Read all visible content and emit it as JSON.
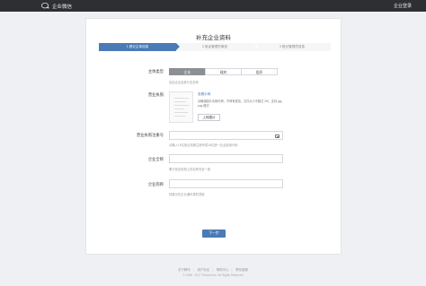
{
  "header": {
    "brand": "企业微信",
    "login_label": "企业登录"
  },
  "card": {
    "title": "补充企业资料",
    "steps": [
      {
        "label": "1.登记主体信息",
        "active": true
      },
      {
        "label": "2.验证管理员微信",
        "active": false
      },
      {
        "label": "3.登记管理员信息",
        "active": false
      }
    ]
  },
  "form": {
    "entity_type": {
      "label": "主体类型",
      "options": [
        "企业",
        "政府",
        "组织"
      ],
      "selected": "企业",
      "hint": "包括企业及其分支机构"
    },
    "license": {
      "label": "营业执照",
      "example_link": "查看示例",
      "description": "请确保图片清晰可辨，不得有遮挡，文件大小不超过 2M，支持 jpg、png 格式",
      "upload_button": "上传图片"
    },
    "license_number": {
      "label": "营业执照注册号",
      "value": "",
      "hint": "请输入15位营业执照注册号或18位统一社会信用代码"
    },
    "company_full_name": {
      "label": "企业全称",
      "value": "",
      "hint": "需与营业执照上的名称完全一致"
    },
    "company_short_name": {
      "label": "企业简称",
      "value": "",
      "hint": "将展示在企业通讯录的顶部"
    },
    "next_button": "下一步"
  },
  "footer": {
    "links": [
      "关于腾讯",
      "用户协议",
      "帮助中心",
      "联系客服"
    ],
    "copyright": "© 1998 - 2017 Tencent Inc. All Rights Reserved"
  }
}
